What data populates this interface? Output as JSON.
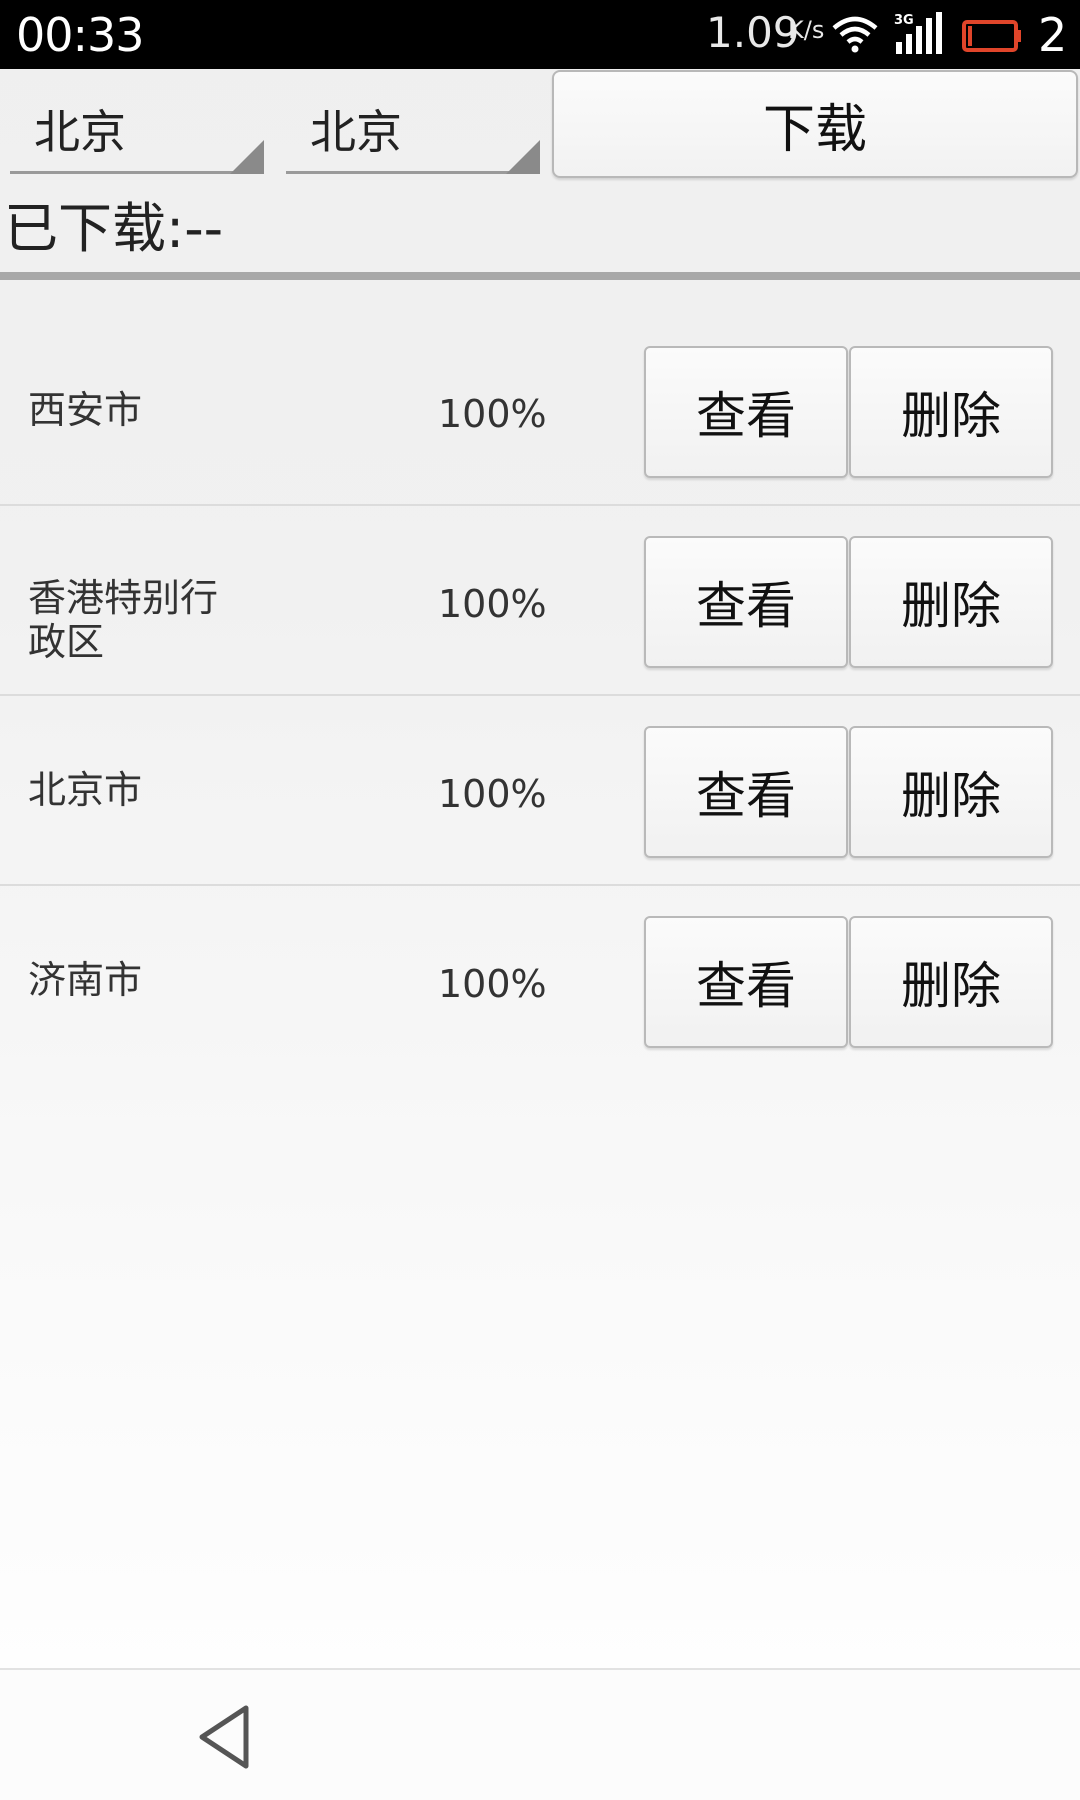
{
  "status_bar": {
    "time": "00:33",
    "speed": "1.09",
    "speed_unit": "K/s",
    "network": "3G",
    "battery_level": "2",
    "battery_color": "#e0452a",
    "icons": [
      "wifi-icon",
      "signal-3g-icon",
      "battery-icon"
    ]
  },
  "controls": {
    "province": "北京",
    "city": "北京",
    "download_label": "下载"
  },
  "downloaded_label": "已下载:--",
  "items": [
    {
      "name": "西安市",
      "percent": "100%",
      "view": "查看",
      "delete": "删除"
    },
    {
      "name": "香港特别行政区",
      "percent": "100%",
      "view": "查看",
      "delete": "删除"
    },
    {
      "name": "北京市",
      "percent": "100%",
      "view": "查看",
      "delete": "删除"
    },
    {
      "name": "济南市",
      "percent": "100%",
      "view": "查看",
      "delete": "删除"
    }
  ],
  "nav": {
    "back_icon": "back-triangle-icon"
  }
}
